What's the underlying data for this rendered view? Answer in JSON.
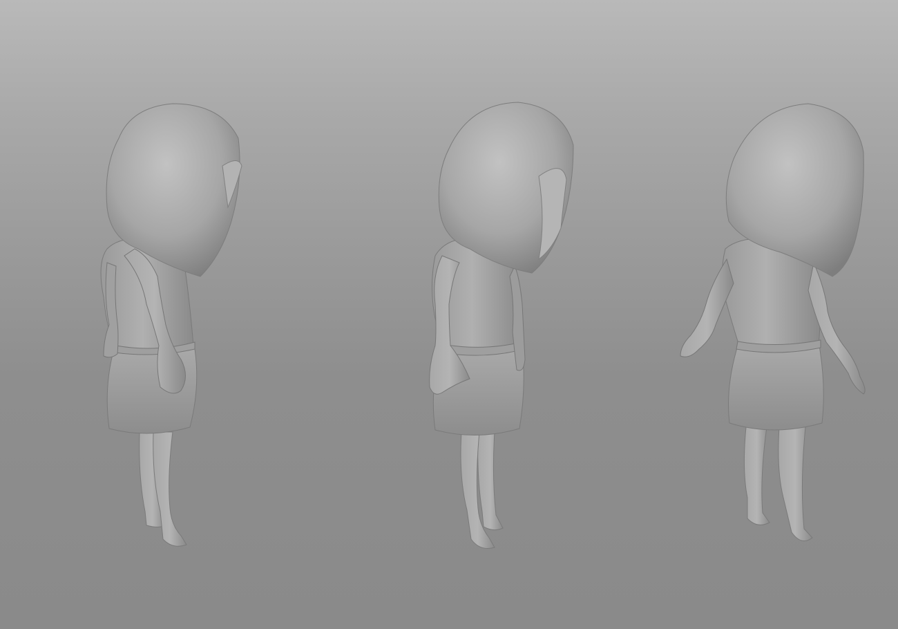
{
  "scene": {
    "background_top": "#b9b9b9",
    "background_bottom": "#8a8a8a",
    "clay_color": "#a5a5a5",
    "clay_shadow": "#7c7c7c",
    "clay_highlight": "#c4c4c4",
    "figures": [
      {
        "view": "side-left"
      },
      {
        "view": "three-quarter"
      },
      {
        "view": "back-three-quarter"
      }
    ]
  }
}
